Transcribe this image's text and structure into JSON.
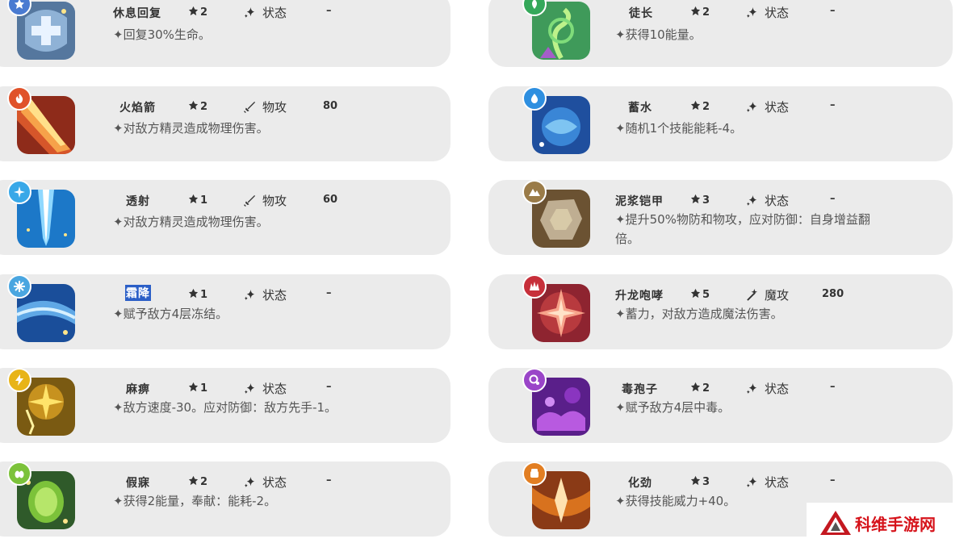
{
  "skills": [
    {
      "name": "休息回复",
      "cost": "2",
      "category": "状态",
      "power": "–",
      "desc": "✦回复30%生命。",
      "element": "normal-type",
      "badge_color": "#4a7bd1",
      "art": "rest"
    },
    {
      "name": "徒长",
      "cost": "2",
      "category": "状态",
      "power": "–",
      "desc": "✦获得10能量。",
      "element": "grass-type",
      "badge_color": "#35a85a",
      "art": "vine"
    },
    {
      "name": "火焰箭",
      "cost": "2",
      "category": "物攻",
      "power": "80",
      "desc": "✦对敌方精灵造成物理伤害。",
      "element": "fire-type",
      "badge_color": "#e0522a",
      "art": "fire"
    },
    {
      "name": "蓄水",
      "cost": "2",
      "category": "状态",
      "power": "–",
      "desc": "✦随机1个技能能耗-4。",
      "element": "water-type",
      "badge_color": "#2e8fe0",
      "art": "water"
    },
    {
      "name": "透射",
      "cost": "1",
      "category": "物攻",
      "power": "60",
      "desc": "✦对敌方精灵造成物理伤害。",
      "element": "light-type",
      "badge_color": "#38a8e8",
      "art": "beam"
    },
    {
      "name": "泥浆铠甲",
      "cost": "3",
      "category": "状态",
      "power": "–",
      "desc": "✦提升50%物防和物攻，应对防御：自身增益翻",
      "desc2": "倍。",
      "element": "ground-type",
      "badge_color": "#9a7b48",
      "art": "rock"
    },
    {
      "name": "霜降",
      "cost": "1",
      "category": "状态",
      "power": "–",
      "desc": "✦赋予敌方4层冻结。",
      "element": "ice-type",
      "badge_color": "#4aa6e0",
      "art": "ice",
      "highlight": true
    },
    {
      "name": "升龙咆哮",
      "cost": "5",
      "category": "魔攻",
      "power": "280",
      "desc": "✦蓄力，对敌方造成魔法伤害。",
      "element": "dragon-type",
      "badge_color": "#c72f3a",
      "art": "dragon"
    },
    {
      "name": "麻痹",
      "cost": "1",
      "category": "状态",
      "power": "–",
      "desc": "✦敌方速度-30。应对防御：敌方先手-1。",
      "element": "electric-type",
      "badge_color": "#e8b418",
      "art": "electric"
    },
    {
      "name": "毒孢子",
      "cost": "2",
      "category": "状态",
      "power": "–",
      "desc": "✦赋予敌方4层中毒。",
      "element": "poison-type",
      "badge_color": "#9a45c8",
      "art": "poison"
    },
    {
      "name": "假寐",
      "cost": "2",
      "category": "状态",
      "power": "–",
      "desc": "✦获得2能量，奉献：能耗-2。",
      "element": "bug-type",
      "badge_color": "#7cc23a",
      "art": "sleep"
    },
    {
      "name": "化劲",
      "cost": "3",
      "category": "状态",
      "power": "–",
      "desc": "✦获得技能威力+40。",
      "element": "fighting-type",
      "badge_color": "#e27e22",
      "art": "fight"
    }
  ],
  "watermark": {
    "text": "科维手游网"
  }
}
